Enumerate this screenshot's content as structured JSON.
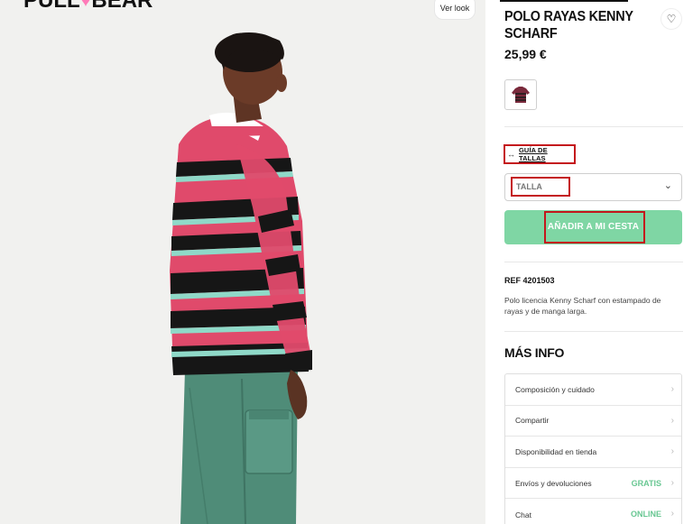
{
  "header": {
    "logo_left": "PULL",
    "logo_right": "BEAR",
    "ver_look": "Ver look"
  },
  "product": {
    "title": "POLO RAYAS KENNY SCHARF",
    "price": "25,99 €",
    "size_guide_label": "GUÍA DE TALLAS",
    "size_select_placeholder": "TALLA",
    "add_to_cart_label": "AÑADIR A MI CESTA",
    "ref": "REF 4201503",
    "description": "Polo licencia Kenny Scharf con estampado de rayas y de manga larga."
  },
  "more_info": {
    "heading": "MÁS INFO",
    "items": [
      {
        "label": "Composición y cuidado",
        "badge": ""
      },
      {
        "label": "Compartir",
        "badge": ""
      },
      {
        "label": "Disponibilidad en tienda",
        "badge": ""
      },
      {
        "label": "Envíos y devoluciones",
        "badge": "GRATIS"
      },
      {
        "label": "Chat",
        "badge": "ONLINE"
      }
    ]
  },
  "icons": {
    "wishlist": "heart-icon",
    "size_guide": "ruler-icon",
    "select": "chevron-down-icon",
    "accordion": "chevron-right-icon"
  },
  "colors": {
    "accent_green": "#7fd6a4",
    "highlight_red": "#c4161c",
    "badge_green": "#68c792",
    "logo_heart": "#ff7ab8"
  }
}
